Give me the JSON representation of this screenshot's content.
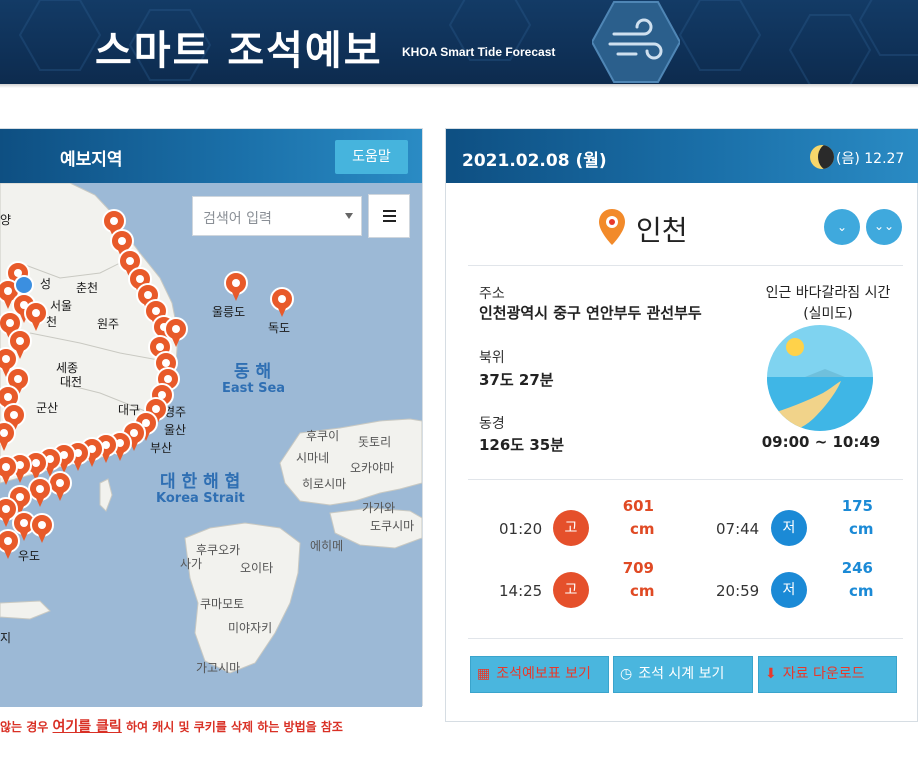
{
  "header": {
    "title": "스마트 조석예보",
    "subtitle": "KHOA Smart Tide Forecast"
  },
  "map_panel": {
    "title": "예보지역",
    "help_label": "도움말",
    "search_placeholder": "검색어 입력",
    "labels": {
      "dokdo": "독도",
      "ulleungdo": "울릉도",
      "chuncheon": "춘천",
      "seoul": "서울",
      "wonju": "원주",
      "sejong": "세종",
      "daejeon": "대전",
      "gunsan": "군산",
      "daegu": "대구",
      "busan": "부산",
      "ulsan": "울산",
      "gyeongju": "경주",
      "seong": "성",
      "cheon": "천",
      "yang": "양",
      "udo": "우도",
      "ji": "지",
      "east_sea_kr": "동 해",
      "east_sea_en": "East Sea",
      "korea_strait_kr": "대 한 해 협",
      "korea_strait_en": "Korea Strait",
      "hukui": "후쿠이",
      "dottori": "돗토리",
      "simane": "시마네",
      "okayama": "오카야마",
      "hiroshima": "히로시마",
      "kagawa": "가가와",
      "dokushima": "도쿠시마",
      "ehime": "에히메",
      "fukuoka": "후쿠오카",
      "saga": "사가",
      "oita": "오이타",
      "kumamoto": "쿠마모토",
      "miyazaki": "미야자키",
      "kagoshima": "가고시마"
    }
  },
  "notice": {
    "prefix": "않는 경우 ",
    "link": "여기를 클릭",
    "suffix": " 하여 캐시 및 쿠키를 삭제 하는 방법을 참조"
  },
  "info_panel": {
    "date": "2021.02.08 (월)",
    "lunar": "(음) 12.27",
    "location": "인천",
    "address_label": "주소",
    "address": "인천광역시 중구 연안부두 관선부두",
    "lat_label": "북위",
    "lat": "37도 27분",
    "lon_label": "동경",
    "lon": "126도 35분",
    "ebb_title": "인근 바다갈라짐 시간",
    "ebb_place": "(실미도)",
    "ebb_time": "09:00 ~ 10:49",
    "tides": [
      {
        "time": "01:20",
        "type": "고",
        "value": "601",
        "unit": "cm"
      },
      {
        "time": "07:44",
        "type": "저",
        "value": "175",
        "unit": "cm"
      },
      {
        "time": "14:25",
        "type": "고",
        "value": "709",
        "unit": "cm"
      },
      {
        "time": "20:59",
        "type": "저",
        "value": "246",
        "unit": "cm"
      }
    ],
    "buttons": {
      "table": "조석예보표 보기",
      "clock": "조석 시계 보기",
      "download": "자료 다운로드"
    }
  },
  "colors": {
    "header_bg": "#0f3158",
    "panel_head": "#1a6fa8",
    "accent_blue": "#46b4dd",
    "high_tide": "#e5502b",
    "low_tide": "#1b8ad6",
    "sea": "#9cb9d6",
    "land": "#f2f2ee"
  }
}
